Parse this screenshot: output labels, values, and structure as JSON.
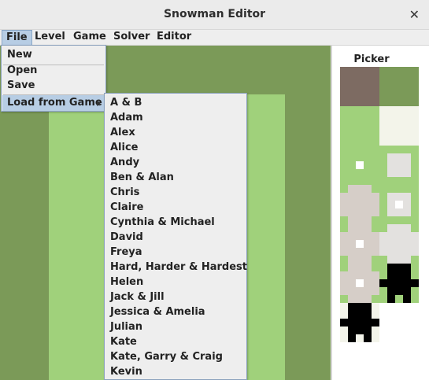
{
  "window": {
    "title": "Snowman Editor",
    "close_glyph": "✕"
  },
  "menubar": {
    "file": "File",
    "level": "Level",
    "game": "Game",
    "solver": "Solver",
    "editor": "Editor"
  },
  "file_menu": {
    "new": "New",
    "open": "Open",
    "save": "Save",
    "load_from_game": "Load from Game"
  },
  "submenu_items": [
    "A & B",
    "Adam",
    "Alex",
    "Alice",
    "Andy",
    "Ben & Alan",
    "Chris",
    "Claire",
    "Cynthia & Michael",
    "David",
    "Freya",
    "Hard, Harder & Hardest",
    "Helen",
    "Jack & Jill",
    "Jessica & Amelia",
    "Julian",
    "Kate",
    "Kate, Garry & Craig",
    "Kevin"
  ],
  "picker": {
    "title": "Picker"
  },
  "colors": {
    "grass_dark": "#7b9a58",
    "grass_light": "#a0d17b",
    "dirt": "#7d6b62",
    "snow": "#d6cec8",
    "highlight": "#b7cde4",
    "menu_bg": "#eeeeee"
  }
}
